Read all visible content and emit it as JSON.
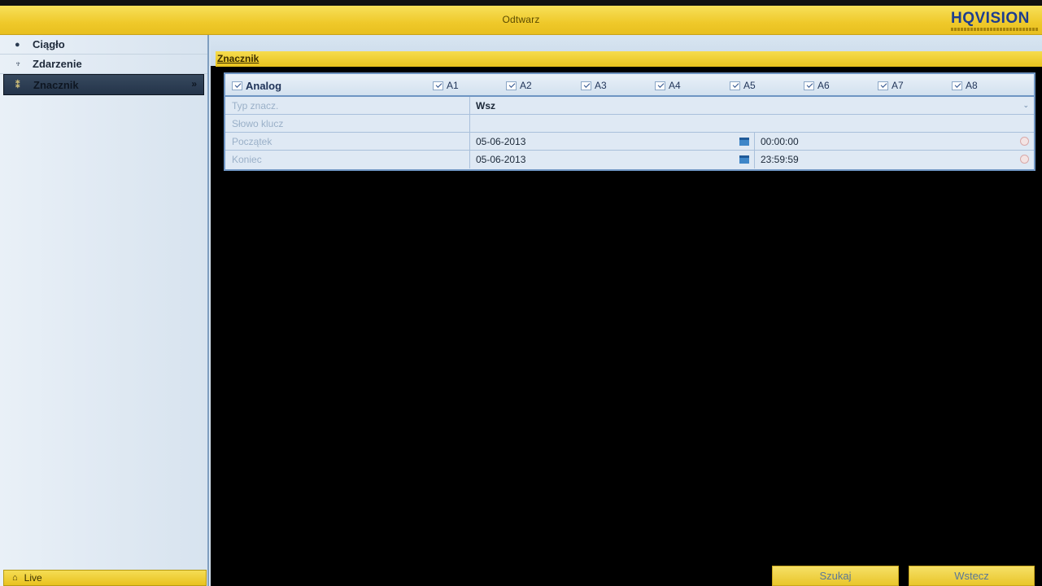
{
  "header": {
    "title": "Odtwarz",
    "logo": "HQVISION"
  },
  "sidebar": {
    "items": [
      {
        "label": "Ciągło",
        "icon": "circle-icon"
      },
      {
        "label": "Zdarzenie",
        "icon": "event-icon"
      },
      {
        "label": "Znacznik",
        "icon": "tag-icon"
      }
    ],
    "live_label": "Live"
  },
  "section": {
    "title": "Znacznik"
  },
  "channels": {
    "analog_label": "Analog",
    "items": [
      "A1",
      "A2",
      "A3",
      "A4",
      "A5",
      "A6",
      "A7",
      "A8"
    ]
  },
  "fields": {
    "type": {
      "label": "Typ znacz.",
      "value": "Wsz"
    },
    "keyword": {
      "label": "Słowo klucz",
      "value": ""
    },
    "start": {
      "label": "Początek",
      "date": "05-06-2013",
      "time": "00:00:00"
    },
    "end": {
      "label": "Koniec",
      "date": "05-06-2013",
      "time": "23:59:59"
    }
  },
  "buttons": {
    "search": "Szukaj",
    "back": "Wstecz"
  },
  "colors": {
    "accent_yellow": "#efc92a",
    "panel_border": "#6f95c3",
    "sidebar_active": "#2e4058"
  }
}
